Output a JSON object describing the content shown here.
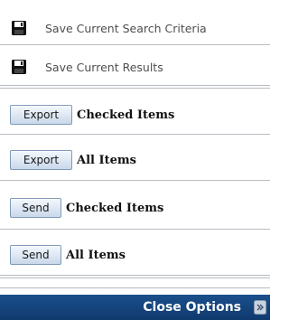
{
  "save_items": [
    {
      "label": "Save Current Search Criteria",
      "icon": "floppy-disk-icon"
    },
    {
      "label": "Save Current Results",
      "icon": "floppy-disk-icon"
    }
  ],
  "actions": [
    {
      "button": "Export",
      "label": "Checked Items"
    },
    {
      "button": "Export",
      "label": "All Items"
    },
    {
      "button": "Send",
      "label": "Checked Items"
    },
    {
      "button": "Send",
      "label": "All Items"
    }
  ],
  "footer": {
    "label": "Close Options",
    "icon": "close-options-icon",
    "background": "#163f78"
  }
}
